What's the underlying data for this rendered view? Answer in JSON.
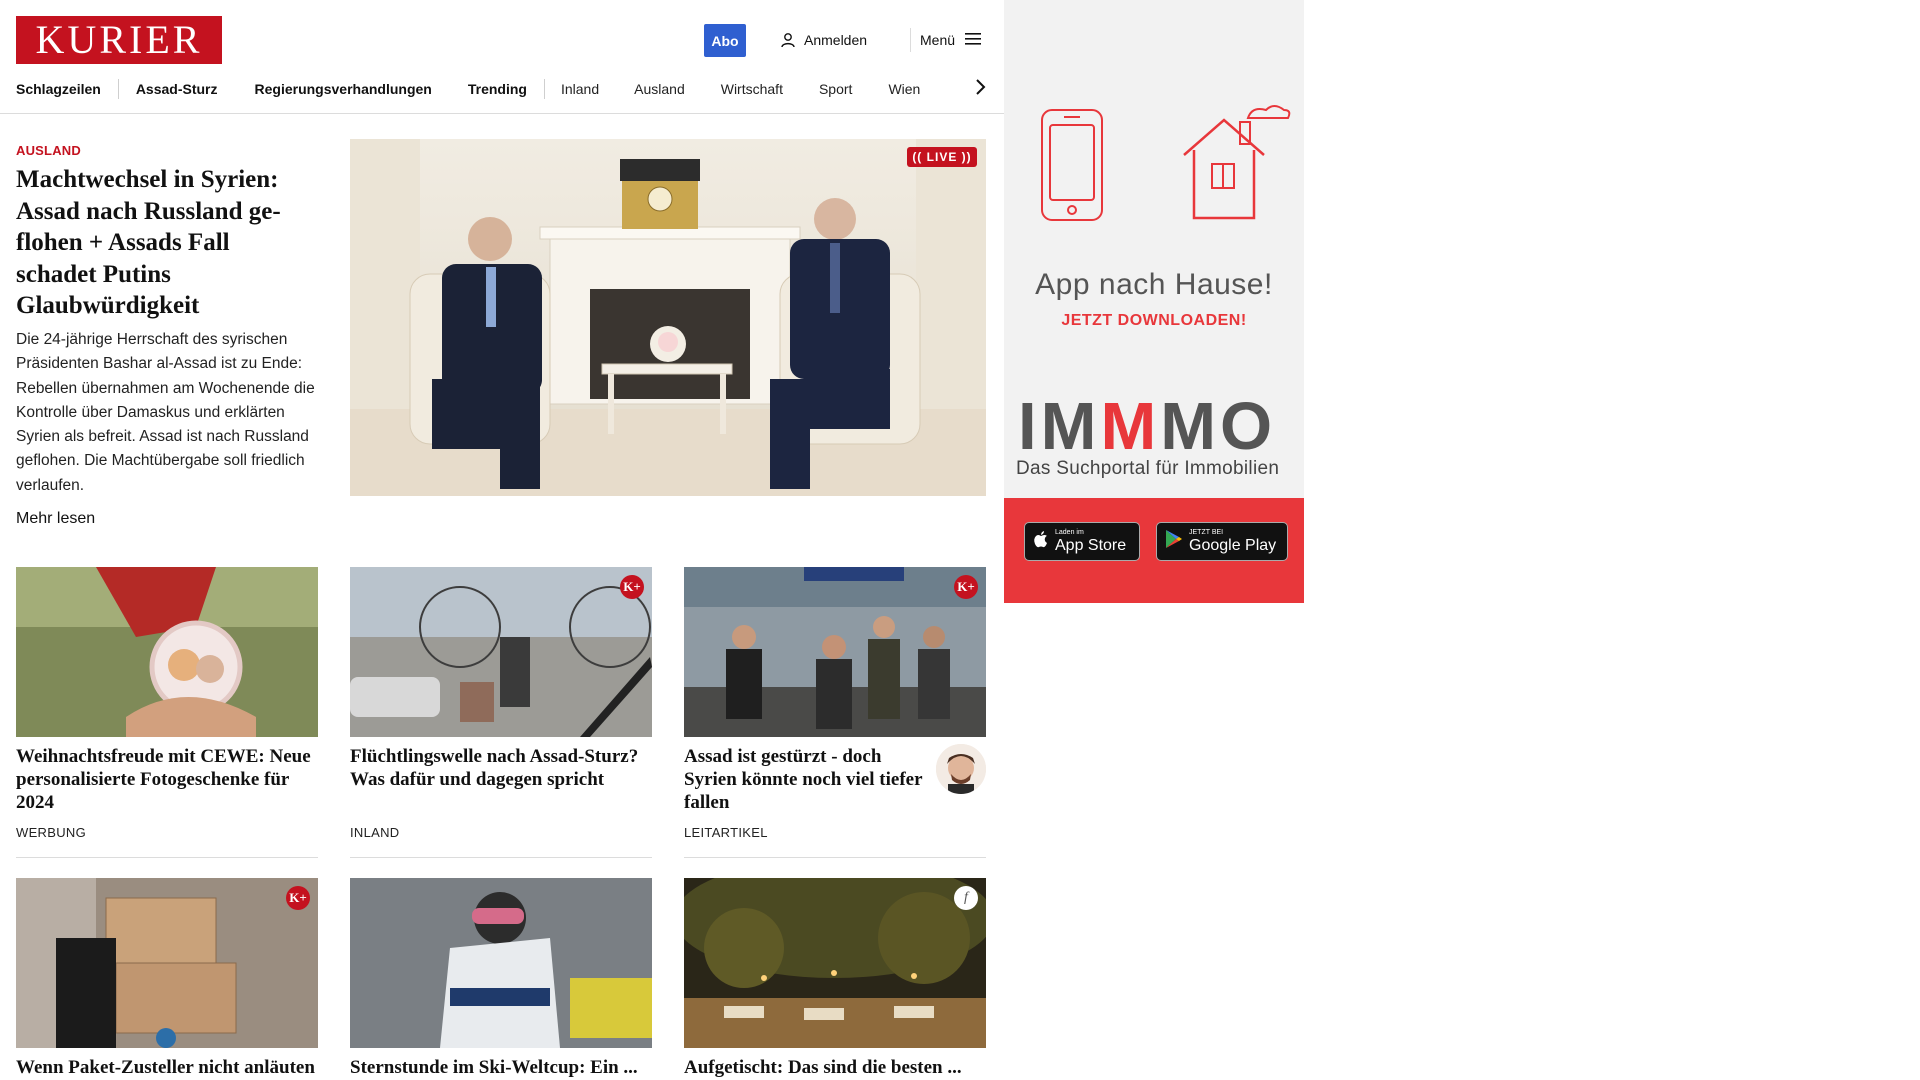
{
  "header": {
    "logo_text": "KURIER",
    "abo_label": "Abo",
    "login_label": "Anmelden",
    "menu_label": "Menü"
  },
  "nav": {
    "items": [
      {
        "label": "Schlagzeilen",
        "bold": true
      },
      {
        "label": "Assad-Sturz",
        "bold": true
      },
      {
        "label": "Regierungsverhandlungen",
        "bold": true
      },
      {
        "label": "Trending",
        "bold": true
      },
      {
        "label": "Inland",
        "bold": false
      },
      {
        "label": "Ausland",
        "bold": false
      },
      {
        "label": "Wirtschaft",
        "bold": false
      },
      {
        "label": "Sport",
        "bold": false
      },
      {
        "label": "Wien",
        "bold": false
      }
    ]
  },
  "hero": {
    "kicker": "AUSLAND",
    "title": "Machtwechsel in Syrien: Assad nach Russland ge­flohen + Assads Fall schadet Putins Glaubwürdigkeit",
    "teaser": "Die 24-jährige Herrschaft des syrischen Präsidenten Bashar al-Assad ist zu Ende: Rebellen übernahmen am Wochenende die Kontrolle über Damaskus und erklärten Syrien als befreit. Assad ist nach Russland geflohen. Die Machtübergabe soll friedlich verlaufen.",
    "more_label": "Mehr lesen",
    "live_label": "LIVE"
  },
  "cards": [
    {
      "title": "Weihnachtsfreude mit CEWE: Neue personalisierte Fotogeschenke für 2024",
      "kicker": "WERBUNG",
      "badge": ""
    },
    {
      "title": "Flüchtlingswelle nach Assad-Sturz? Was dafür und dagegen spricht",
      "kicker": "INLAND",
      "badge": "K+"
    },
    {
      "title": "Assad ist gestürzt - doch Syrien könnte noch viel tie­fer fallen",
      "kicker": "LEITARTIKEL",
      "badge": "K+"
    },
    {
      "title": "Wenn Paket-Zusteller nicht anläu­ten oder auf ..."
    },
    {
      "title": "Sternstunde im Ski-Weltcup: Ein ..."
    },
    {
      "title": "Aufgetischt: Das sind die besten ..."
    }
  ],
  "ad": {
    "title": "App nach Hause!",
    "cta": "JETZT DOWNLOADEN!",
    "brand_a": "IM",
    "brand_m": "M",
    "brand_b": "MO",
    "subtitle": "Das Suchportal für Immobilien",
    "appstore_small": "Laden im",
    "appstore_big": "App Store",
    "googleplay_small": "JETZT BEI",
    "googleplay_big": "Google Play"
  },
  "colors": {
    "brand_red": "#c4121f",
    "abo_blue": "#2f5fd0",
    "ad_red": "#e8373b"
  }
}
